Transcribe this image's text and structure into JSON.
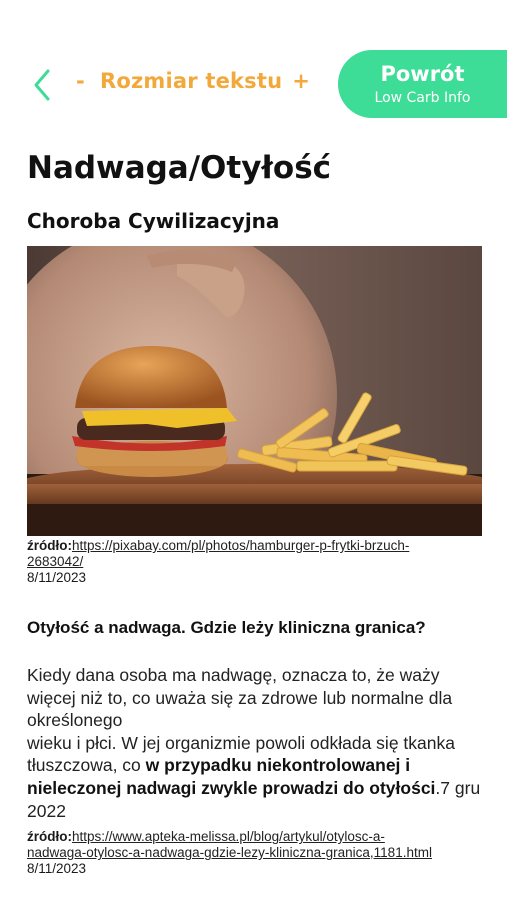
{
  "header": {
    "back_icon": "chevron-left-icon",
    "text_size_minus": "-",
    "text_size_label": "Rozmiar tekstu",
    "text_size_plus": "+",
    "back_button_title": "Powrót",
    "back_button_subtitle": "Low Carb Info",
    "accent_color": "#f2a83a",
    "pill_color": "#3ddc97"
  },
  "article": {
    "title": "Nadwaga/Otyłość",
    "subtitle": "Choroba Cywilizacyjna",
    "image_source": {
      "label": "źródło:",
      "url_line1": "https://pixabay.com/pl/photos/hamburger-p-frytki-brzuch-",
      "url_line2": "2683042/",
      "date": "8/11/2023"
    },
    "section_heading": "Otyłość a nadwaga. Gdzie leży kliniczna granica?",
    "body_part1": "Kiedy dana osoba ma nadwagę, oznacza to, że waży więcej niż to, co uważa się za zdrowe lub normalne dla określonego",
    "body_part2": "wieku i płci. W jej organizmie powoli odkłada się tkanka tłuszczowa, co ",
    "body_bold": "w przypadku niekontrolowanej i nieleczonej nadwagi zwykle prowadzi do otyłości",
    "body_tail": ".7 gru 2022",
    "text_source": {
      "label": "źródło:",
      "url_line1": "https://www.apteka-melissa.pl/blog/artykul/otylosc-a-",
      "url_line2": "nadwaga-otylosc-a-nadwaga-gdzie-lezy-kliniczna-granica,1181.html",
      "date": "8/11/2023"
    }
  }
}
